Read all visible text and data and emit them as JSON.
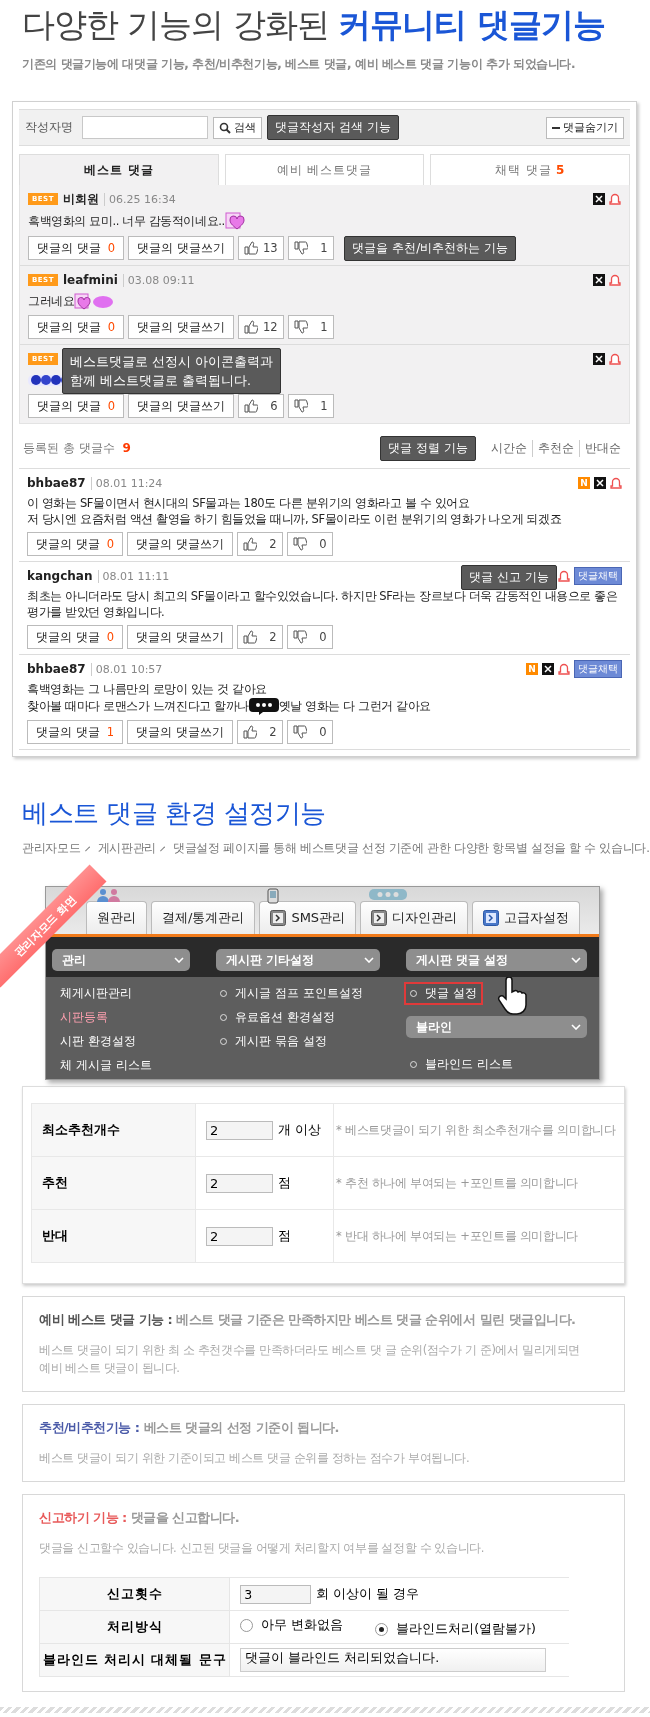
{
  "header": {
    "title": "다양한 기능의 강화된 **커뮤니티 댓글기능**",
    "subtitle": "기존의 댓글기능에 대댓글 기능, 추천/비추천기능, 베스트 댓글, 예비 베스트 댓글 기능이 추가 되었습니다."
  },
  "board": {
    "search": {
      "label": "작성자명",
      "button": "검색",
      "tooltip": "댓글작성자 검색 기능",
      "hide_button": "댓글숨기기"
    },
    "tabs": [
      {
        "label": "베스트 댓글",
        "selected": true
      },
      {
        "label": "예비 베스트댓글",
        "selected": false
      },
      {
        "label": "채택 댓글",
        "count": "5",
        "selected": false
      }
    ],
    "best_comments": [
      {
        "badge": "BEST",
        "author": "비회원",
        "date": "06.25 16:34",
        "lines": [
          [
            {
              "kind": "text",
              "text": "흑백영화의 묘미.. 너무 감동적이네요.."
            },
            {
              "kind": "heart"
            }
          ]
        ],
        "badges": [
          {
            "kind": "delete"
          },
          {
            "kind": "report"
          }
        ],
        "reply_label": "댓글의 댓글",
        "reply_count": "0",
        "write_label": "댓글의 댓글쓰기",
        "up": "13",
        "down": "1",
        "tooltip": {
          "kind": "votes",
          "text": "댓글을 추천/비추천하는 기능"
        }
      },
      {
        "badge": "BEST",
        "author": "leafmini",
        "date": "03.08 09:11",
        "lines": [
          [
            {
              "kind": "text",
              "text": "그러네요"
            },
            {
              "kind": "heart-blob"
            }
          ]
        ],
        "badges": [
          {
            "kind": "delete"
          },
          {
            "kind": "report"
          }
        ],
        "reply_label": "댓글의 댓글",
        "reply_count": "0",
        "write_label": "댓글의 댓글쓰기",
        "up": "12",
        "down": "1"
      },
      {
        "badge": "BEST",
        "lines": [
          [
            {
              "kind": "sticker"
            }
          ]
        ],
        "badges": [
          {
            "kind": "delete"
          },
          {
            "kind": "report"
          }
        ],
        "reply_label": "댓글의 댓글",
        "reply_count": "0",
        "write_label": "댓글의 댓글쓰기",
        "up": "6",
        "down": "1",
        "tooltip": {
          "kind": "header",
          "text": "베스트댓글로 선정시 아이콘출력과\n함께 베스트댓글로 출력됩니다."
        }
      }
    ],
    "total_label": "등록된 총 댓글수",
    "total": "9",
    "sort_tooltip": "댓글 정렬 기능",
    "sort": [
      "시간순",
      "추천순",
      "반대순"
    ],
    "comments": [
      {
        "author": "bhbae87",
        "date": "08.01 11:24",
        "lines": [
          [
            {
              "kind": "text",
              "text": "이 영화는 SF물이면서 현시대의 SF물과는 180도 다른 분위기의 영화라고 볼 수 있어요"
            }
          ],
          [
            {
              "kind": "text",
              "text": "저 당시엔 요즘처럼 액션 촬영을 하기 힘들었을 때니까, SF물이라도 이런 분위기의 영화가 나오게 되겠죠"
            }
          ]
        ],
        "badges": [
          {
            "kind": "new",
            "text": "N"
          },
          {
            "kind": "delete"
          },
          {
            "kind": "report"
          }
        ],
        "reply_label": "댓글의 댓글",
        "reply_count": "0",
        "write_label": "댓글의 댓글쓰기",
        "up": "2",
        "down": "0"
      },
      {
        "author": "kangchan",
        "date": "08.01 11:11",
        "lines": [
          [
            {
              "kind": "text",
              "text": "최초는 아니더라도 당시 최고의 SF물이라고 할수있었습니다. 하지만 SF라는 장르보다 더욱 감동적인 내용으로 좋은 평가를 받았던 영화입니다."
            }
          ]
        ],
        "badges": [
          {
            "kind": "report"
          },
          {
            "kind": "adopt",
            "text": "댓글채택"
          }
        ],
        "reply_label": "댓글의 댓글",
        "reply_count": "0",
        "write_label": "댓글의 댓글쓰기",
        "up": "2",
        "down": "0",
        "tooltip": {
          "kind": "icons",
          "text": "댓글 신고 기능"
        }
      },
      {
        "author": "bhbae87",
        "date": "08.01 10:57",
        "lines": [
          [
            {
              "kind": "text",
              "text": "흑백영화는 그 나름만의 로망이 있는 것 같아요"
            }
          ],
          [
            {
              "kind": "text",
              "text": "찾아볼 때마다 로맨스가 느껴진다고 할까나"
            },
            {
              "kind": "chat"
            },
            {
              "kind": "text",
              "text": "옛날 영화는 다 그런거 같아요"
            }
          ]
        ],
        "badges": [
          {
            "kind": "new",
            "text": "N"
          },
          {
            "kind": "delete"
          },
          {
            "kind": "report"
          },
          {
            "kind": "adopt",
            "text": "댓글채택"
          }
        ],
        "reply_label": "댓글의 댓글",
        "reply_count": "1",
        "write_label": "댓글의 댓글쓰기",
        "up": "2",
        "down": "0"
      }
    ]
  },
  "section": {
    "title": "베스트 댓글 환경 설정기능",
    "breadcrumb": [
      "관리자모드",
      "게시판관리"
    ],
    "description": "댓글설정 페이지를 통해 베스트댓글 선정 기준에 관한 다양한 항목별 설정을 할 수 있습니다."
  },
  "admin": {
    "ribbon": "관리자모드 화면",
    "tabs": [
      {
        "label": "원관리",
        "kind": "people"
      },
      {
        "label": "결제/통계관리",
        "kind": "plain"
      },
      {
        "label": "SMS관리",
        "kind": "phone"
      },
      {
        "label": "디자인관리",
        "kind": "bubble"
      },
      {
        "label": "고급자설정",
        "kind": "active"
      }
    ],
    "columns": [
      {
        "kind": "plain",
        "header": "관리",
        "items": [
          {
            "label": "체게시판관리",
            "selected": false
          },
          {
            "label": "시판등록",
            "selected": true
          },
          {
            "label": "시판 환경설정",
            "selected": false
          },
          {
            "label": "체 게시글 리스트",
            "selected": false
          }
        ]
      },
      {
        "kind": "bullet",
        "header": "게시판 기타설정",
        "items": [
          {
            "label": "게시글 점프 포인트설정",
            "selected": false
          },
          {
            "label": "유료옵션 환경설정",
            "selected": false
          },
          {
            "label": "게시판 묶음 설정",
            "selected": false
          }
        ]
      },
      {
        "kind": "bullet",
        "header": "게시판 댓글 설정",
        "items": [
          {
            "label": "댓글 설정",
            "selected": true
          }
        ],
        "sub_header": "블라인",
        "sub_items": [
          {
            "label": "블라인드 리스트",
            "selected": false
          }
        ]
      }
    ]
  },
  "settings": [
    {
      "label": "최소추천개수",
      "value": "2",
      "unit": "개 이상",
      "note": "* 베스트댓글이 되기 위한 최소추천개수를 의미합니다"
    },
    {
      "label": "추천",
      "value": "2",
      "unit": "점",
      "note": "* 추천 하나에 부여되는 +포인트를 의미합니다"
    },
    {
      "label": "반대",
      "value": "2",
      "unit": "점",
      "note": "* 반대 하나에 부여되는 +포인트를 의미합니다"
    }
  ],
  "info_boxes": [
    {
      "color": "#555555",
      "title": "**예비 베스트 댓글 기능 :** 베스트 댓글 기준은 만족하지만 베스트 댓글 순위에서 밀린 댓글입니다.",
      "text": "베스트 댓글이 되기 위한 최 소 추천갯수를 만족하더라도 베스트 댓 글 순위(점수가 기 준)에서 밀리게되면\n예비 베스트 댓글이 됩니다."
    },
    {
      "color": "#4a5aa8",
      "title": "**추천/비추천기능 :** 베스트 댓글의 선정 기준이 됩니다.",
      "text": "베스트 댓글이 되기 위한 기준이되고 베스트 댓글 순위를 정하는 점수가 부여됩니다."
    },
    {
      "color": "#e85a5a",
      "title": "**신고하기 기능 :** 댓글을 신고합니다.",
      "text": "댓글을 신고할수 있습니다. 신고된 댓글을 어떻게 처리할지 여부를 설정할 수 있습니다.",
      "form": [
        {
          "kind": "number",
          "label": "신고횟수",
          "value": "3",
          "unit": "회 이상이 될 경우"
        },
        {
          "kind": "radio",
          "label": "처리방식",
          "options": [
            {
              "label": "아무 변화없음",
              "selected": false
            },
            {
              "label": "블라인드처리(열람불가)",
              "selected": true
            }
          ]
        },
        {
          "kind": "text",
          "label": "블라인드 처리시 대체될 문구",
          "value": "댓글이 블라인드 처리되었습니다."
        }
      ]
    }
  ]
}
